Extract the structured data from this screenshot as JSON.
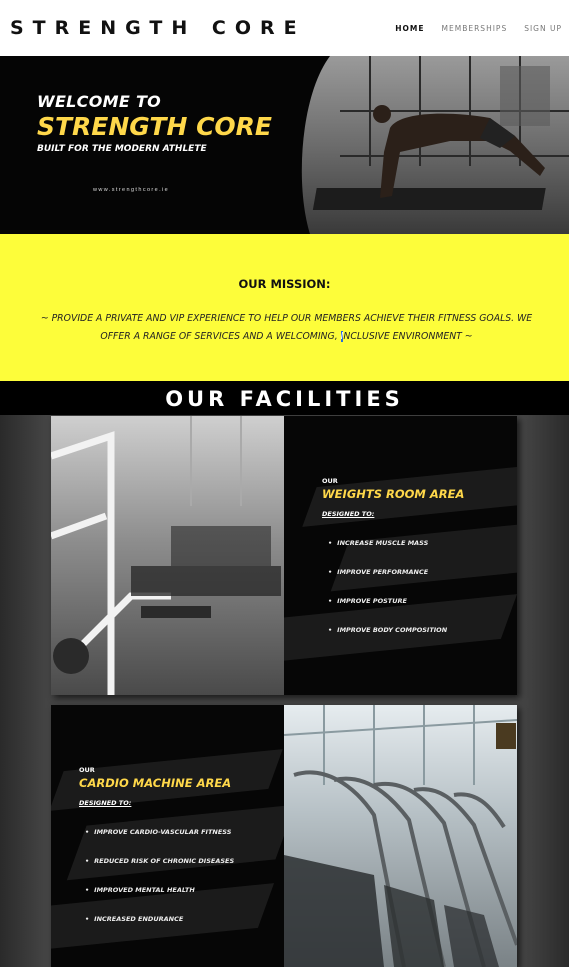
{
  "header": {
    "logo": "STRENGTH CORE",
    "nav": [
      {
        "label": "HOME",
        "active": true
      },
      {
        "label": "MEMBERSHIPS",
        "active": false
      },
      {
        "label": "SIGN UP",
        "active": false
      }
    ]
  },
  "hero": {
    "welcome": "WELCOME TO",
    "brand": "STRENGTH CORE",
    "tagline": "BUILT FOR THE MODERN ATHLETE",
    "url": "www.strengthcore.ie"
  },
  "mission": {
    "title": "OUR MISSION:",
    "text_before": "~ PROVIDE A PRIVATE AND VIP EXPERIENCE TO HELP OUR MEMBERS ACHIEVE THEIR FITNESS GOALS. WE OFFER A RANGE OF SERVICES AND A WELCOMING, ",
    "text_selected": "I",
    "text_after": "NCLUSIVE ENVIRONMENT ~"
  },
  "facilities": {
    "title": "OUR FACILITIES",
    "cards": [
      {
        "our": "OUR",
        "title": "WEIGHTS ROOM AREA",
        "subtitle": "DESIGNED TO:",
        "items": [
          "INCREASE MUSCLE MASS",
          "IMPROVE PERFORMANCE",
          "IMPROVE POSTURE",
          "IMPROVE BODY COMPOSITION"
        ]
      },
      {
        "our": "OUR",
        "title": "CARDIO MACHINE AREA",
        "subtitle": "DESIGNED TO:",
        "items": [
          "IMPROVE CARDIO-VASCULAR FITNESS",
          "REDUCED RISK OF CHRONIC DISEASES",
          "IMPROVED MENTAL HEALTH",
          "INCREASED ENDURANCE"
        ]
      }
    ]
  },
  "colors": {
    "accent_yellow": "#ffd84a",
    "mission_bg": "#fdfd3a",
    "dark": "#000000"
  }
}
